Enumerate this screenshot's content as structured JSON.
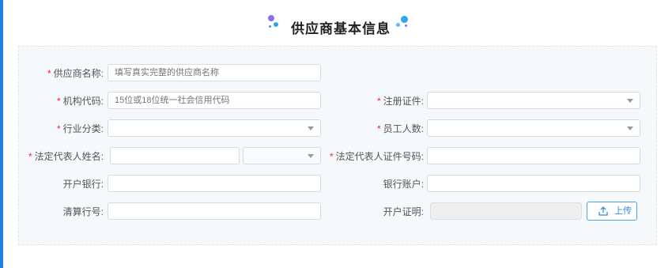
{
  "page_title": "供应商基本信息",
  "form": {
    "supplier_name": {
      "label": "供应商名称:",
      "required": true,
      "placeholder": "填写真实完整的供应商名称",
      "value": ""
    },
    "org_code": {
      "label": "机构代码:",
      "required": true,
      "placeholder": "15位或18位统一社会信用代码",
      "value": ""
    },
    "reg_certificate": {
      "label": "注册证件:",
      "required": true,
      "value": ""
    },
    "industry": {
      "label": "行业分类:",
      "required": true,
      "value": ""
    },
    "employees": {
      "label": "员工人数:",
      "required": true,
      "value": ""
    },
    "legal_rep_name": {
      "label": "法定代表人姓名:",
      "required": true,
      "value": "",
      "title_value": ""
    },
    "legal_rep_id": {
      "label": "法定代表人证件号码:",
      "required": true,
      "value": ""
    },
    "bank": {
      "label": "开户银行:",
      "required": false,
      "value": ""
    },
    "bank_account": {
      "label": "银行账户:",
      "required": false,
      "value": ""
    },
    "clearing_no": {
      "label": "清算行号:",
      "required": false,
      "value": ""
    },
    "account_cert": {
      "label": "开户证明:",
      "required": false,
      "value": ""
    },
    "upload_label": "上传"
  },
  "colors": {
    "accent": "#1f7fe0",
    "required_mark": "#f5222d",
    "upload": "#2f8ee0"
  }
}
